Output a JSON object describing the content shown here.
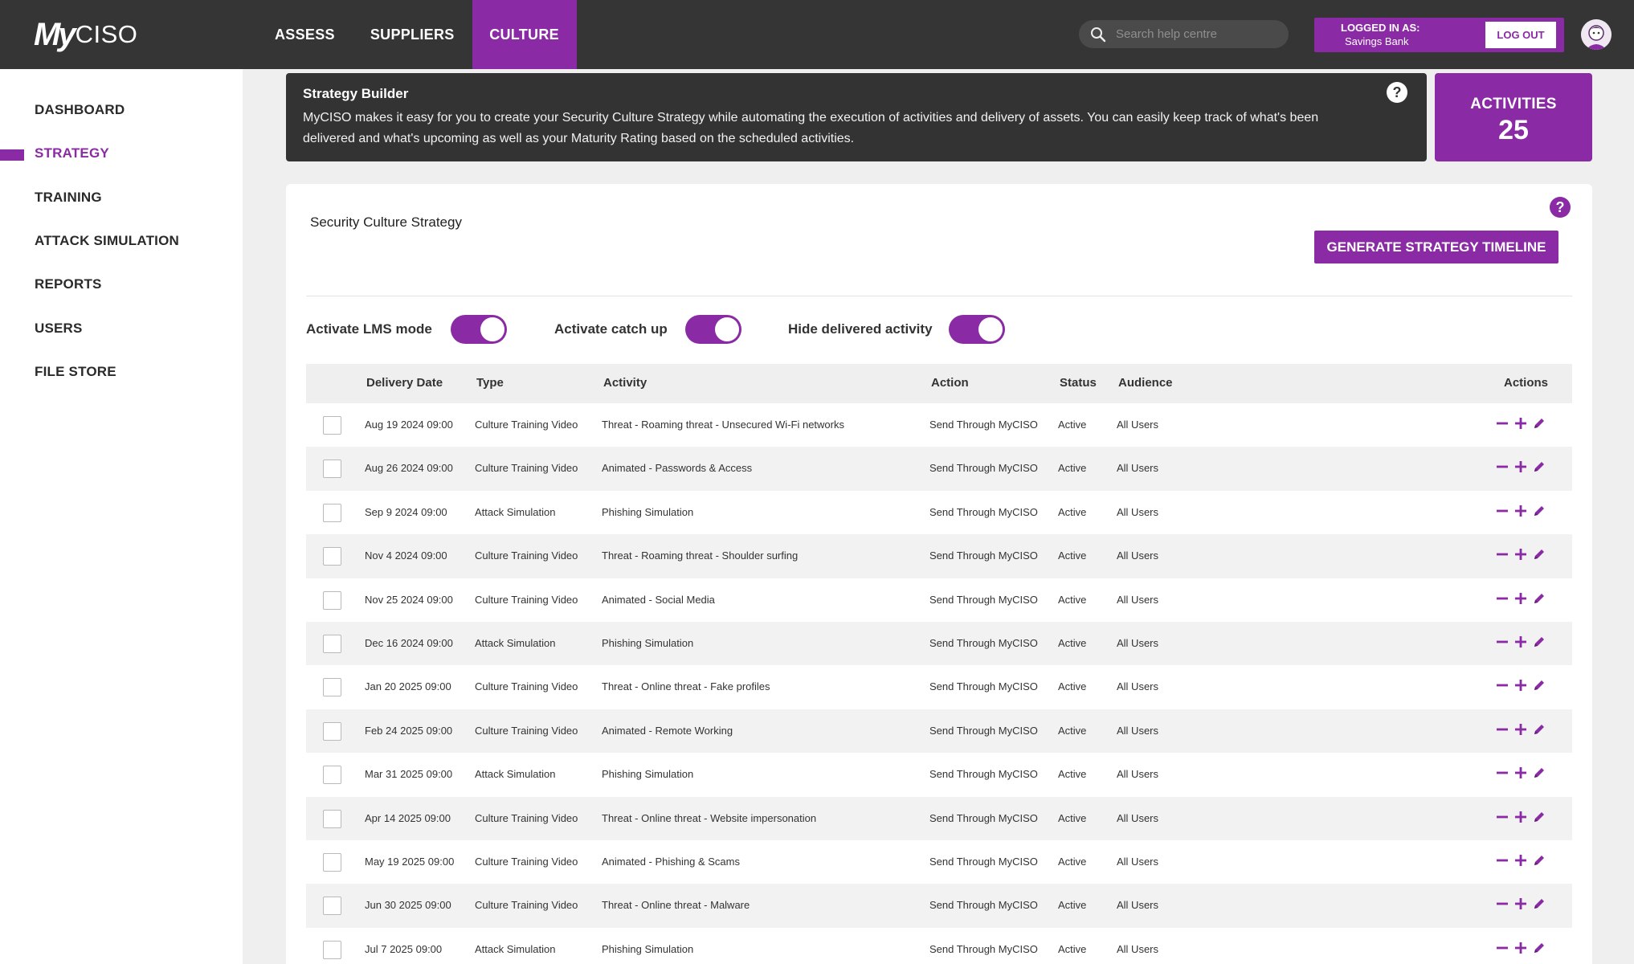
{
  "brand": {
    "logo_my": "My",
    "logo_ciso": "CISO"
  },
  "nav": [
    {
      "label": "ASSESS",
      "active": false
    },
    {
      "label": "SUPPLIERS",
      "active": false
    },
    {
      "label": "CULTURE",
      "active": true
    }
  ],
  "search": {
    "placeholder": "Search help centre"
  },
  "login": {
    "label": "LOGGED IN AS:",
    "name": "Savings Bank",
    "logout": "LOG OUT"
  },
  "sidebar": {
    "items": [
      {
        "label": "DASHBOARD",
        "active": false
      },
      {
        "label": "STRATEGY",
        "active": true
      },
      {
        "label": "TRAINING",
        "active": false
      },
      {
        "label": "ATTACK SIMULATION",
        "active": false
      },
      {
        "label": "REPORTS",
        "active": false
      },
      {
        "label": "USERS",
        "active": false
      },
      {
        "label": "FILE STORE",
        "active": false
      }
    ]
  },
  "banner": {
    "title": "Strategy Builder",
    "text": "MyCISO makes it easy for you to create your Security Culture Strategy while automating the execution of activities and delivery of assets. You can easily keep track of what's been delivered and what's upcoming as well as your Maturity Rating based on the scheduled activities.",
    "help": "?"
  },
  "activities": {
    "label": "ACTIVITIES",
    "count": "25"
  },
  "panel": {
    "title": "Security Culture Strategy",
    "help": "?",
    "generate_button": "GENERATE STRATEGY TIMELINE"
  },
  "toggles": [
    {
      "label": "Activate LMS mode",
      "on": true
    },
    {
      "label": "Activate catch up",
      "on": true
    },
    {
      "label": "Hide delivered activity",
      "on": true
    }
  ],
  "table": {
    "headers": {
      "date": "Delivery Date",
      "type": "Type",
      "activity": "Activity",
      "action": "Action",
      "status": "Status",
      "audience": "Audience",
      "actions": "Actions"
    },
    "rows": [
      {
        "date": "Aug 19 2024 09:00",
        "type": "Culture Training Video",
        "activity": "Threat - Roaming threat - Unsecured Wi-Fi networks",
        "action": "Send Through MyCISO",
        "status": "Active",
        "audience": "All Users"
      },
      {
        "date": "Aug 26 2024 09:00",
        "type": "Culture Training Video",
        "activity": "Animated - Passwords & Access",
        "action": "Send Through MyCISO",
        "status": "Active",
        "audience": "All Users"
      },
      {
        "date": "Sep 9 2024 09:00",
        "type": "Attack Simulation",
        "activity": "Phishing Simulation",
        "action": "Send Through MyCISO",
        "status": "Active",
        "audience": "All Users"
      },
      {
        "date": "Nov 4 2024 09:00",
        "type": "Culture Training Video",
        "activity": "Threat - Roaming threat - Shoulder surfing",
        "action": "Send Through MyCISO",
        "status": "Active",
        "audience": "All Users"
      },
      {
        "date": "Nov 25 2024 09:00",
        "type": "Culture Training Video",
        "activity": "Animated - Social Media",
        "action": "Send Through MyCISO",
        "status": "Active",
        "audience": "All Users"
      },
      {
        "date": "Dec 16 2024 09:00",
        "type": "Attack Simulation",
        "activity": "Phishing Simulation",
        "action": "Send Through MyCISO",
        "status": "Active",
        "audience": "All Users"
      },
      {
        "date": "Jan 20 2025 09:00",
        "type": "Culture Training Video",
        "activity": "Threat - Online threat - Fake profiles",
        "action": "Send Through MyCISO",
        "status": "Active",
        "audience": "All Users"
      },
      {
        "date": "Feb 24 2025 09:00",
        "type": "Culture Training Video",
        "activity": "Animated - Remote Working",
        "action": "Send Through MyCISO",
        "status": "Active",
        "audience": "All Users"
      },
      {
        "date": "Mar 31 2025 09:00",
        "type": "Attack Simulation",
        "activity": "Phishing Simulation",
        "action": "Send Through MyCISO",
        "status": "Active",
        "audience": "All Users"
      },
      {
        "date": "Apr 14 2025 09:00",
        "type": "Culture Training Video",
        "activity": "Threat - Online threat - Website impersonation",
        "action": "Send Through MyCISO",
        "status": "Active",
        "audience": "All Users"
      },
      {
        "date": "May 19 2025 09:00",
        "type": "Culture Training Video",
        "activity": "Animated - Phishing & Scams",
        "action": "Send Through MyCISO",
        "status": "Active",
        "audience": "All Users"
      },
      {
        "date": "Jun 30 2025 09:00",
        "type": "Culture Training Video",
        "activity": "Threat - Online threat - Malware",
        "action": "Send Through MyCISO",
        "status": "Active",
        "audience": "All Users"
      },
      {
        "date": "Jul 7 2025 09:00",
        "type": "Attack Simulation",
        "activity": "Phishing Simulation",
        "action": "Send Through MyCISO",
        "status": "Active",
        "audience": "All Users"
      }
    ]
  },
  "colors": {
    "accent": "#8a2aa5",
    "topbar": "#353535"
  }
}
